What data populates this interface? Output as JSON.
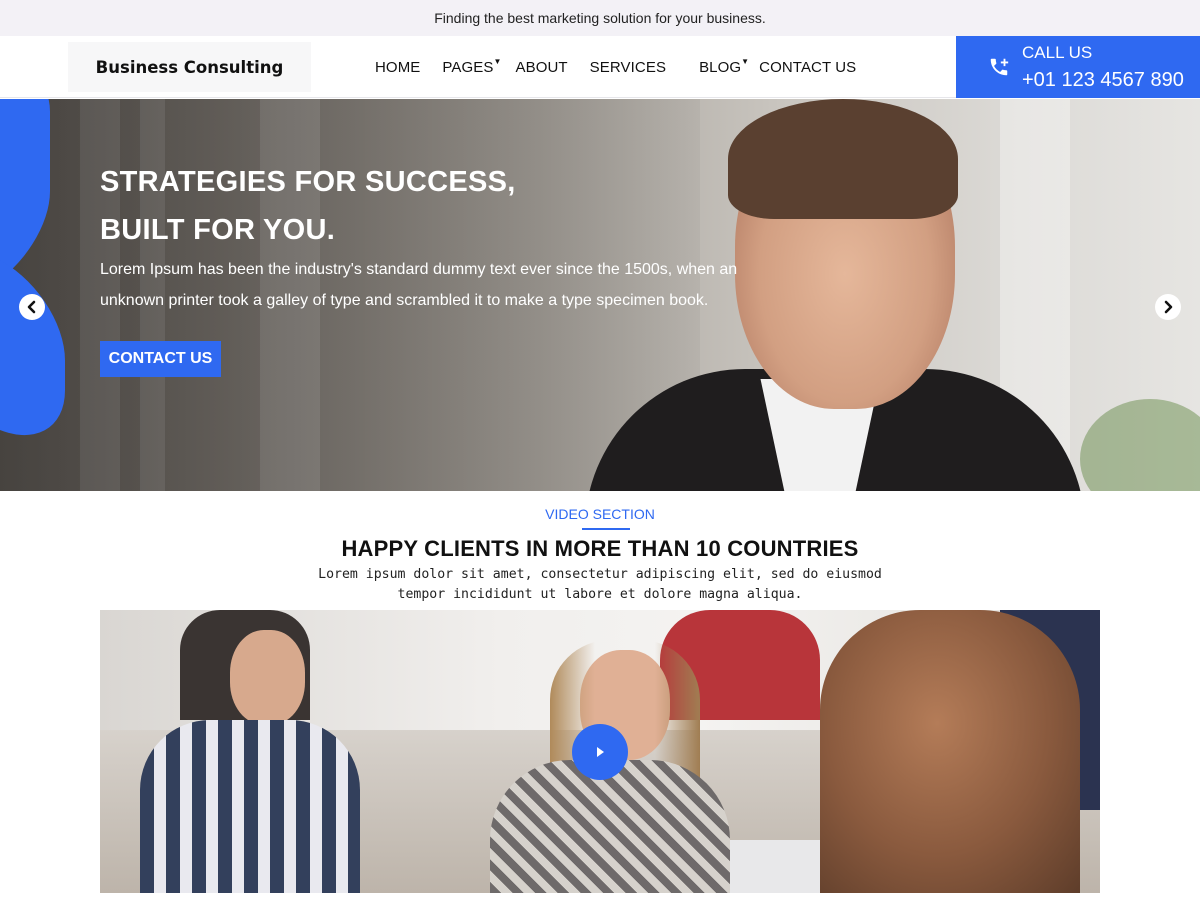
{
  "topbar": {
    "text": "Finding the best marketing solution for your business."
  },
  "header": {
    "logo": "Business Consulting",
    "nav": [
      {
        "label": "HOME",
        "dropdown": false
      },
      {
        "label": "PAGES",
        "dropdown": true
      },
      {
        "label": "ABOUT",
        "dropdown": false
      },
      {
        "label": "SERVICES",
        "dropdown": false
      },
      {
        "label": "BLOG",
        "dropdown": true
      },
      {
        "label": "CONTACT US",
        "dropdown": false
      }
    ],
    "call": {
      "label": "CALL US",
      "number": "+01 123 4567 890",
      "icon": "phone-plus-icon"
    }
  },
  "hero": {
    "title_line1": "STRATEGIES FOR SUCCESS,",
    "title_line2": "BUILT FOR YOU.",
    "text": "Lorem Ipsum has been the industry's standard dummy text ever since the 1500s, when an unknown printer took a galley of type and scrambled it to make a type specimen book.",
    "button": "CONTACT US",
    "prev_icon": "chevron-left-icon",
    "next_icon": "chevron-right-icon"
  },
  "video_section": {
    "label": "VIDEO SECTION",
    "title": "HAPPY CLIENTS IN MORE THAN 10 COUNTRIES",
    "text": "Lorem ipsum dolor sit amet, consectetur adipiscing elit, sed do eiusmod tempor incididunt ut labore et dolore magna aliqua.",
    "play_icon": "play-icon"
  },
  "colors": {
    "accent": "#2f69f1",
    "topbar_bg": "#f3f1f6"
  }
}
